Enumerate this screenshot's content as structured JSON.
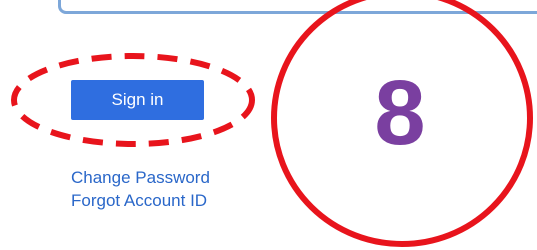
{
  "login": {
    "sign_in_label": "Sign in",
    "change_password_label": "Change Password",
    "forgot_account_id_label": "Forgot Account ID"
  },
  "annotation": {
    "step_number": "8",
    "highlight_color": "#e8141c",
    "number_color": "#7a3fa0"
  },
  "colors": {
    "button": "#2f6ee0",
    "link": "#2a67c9",
    "field_border": "#7da7d9"
  }
}
